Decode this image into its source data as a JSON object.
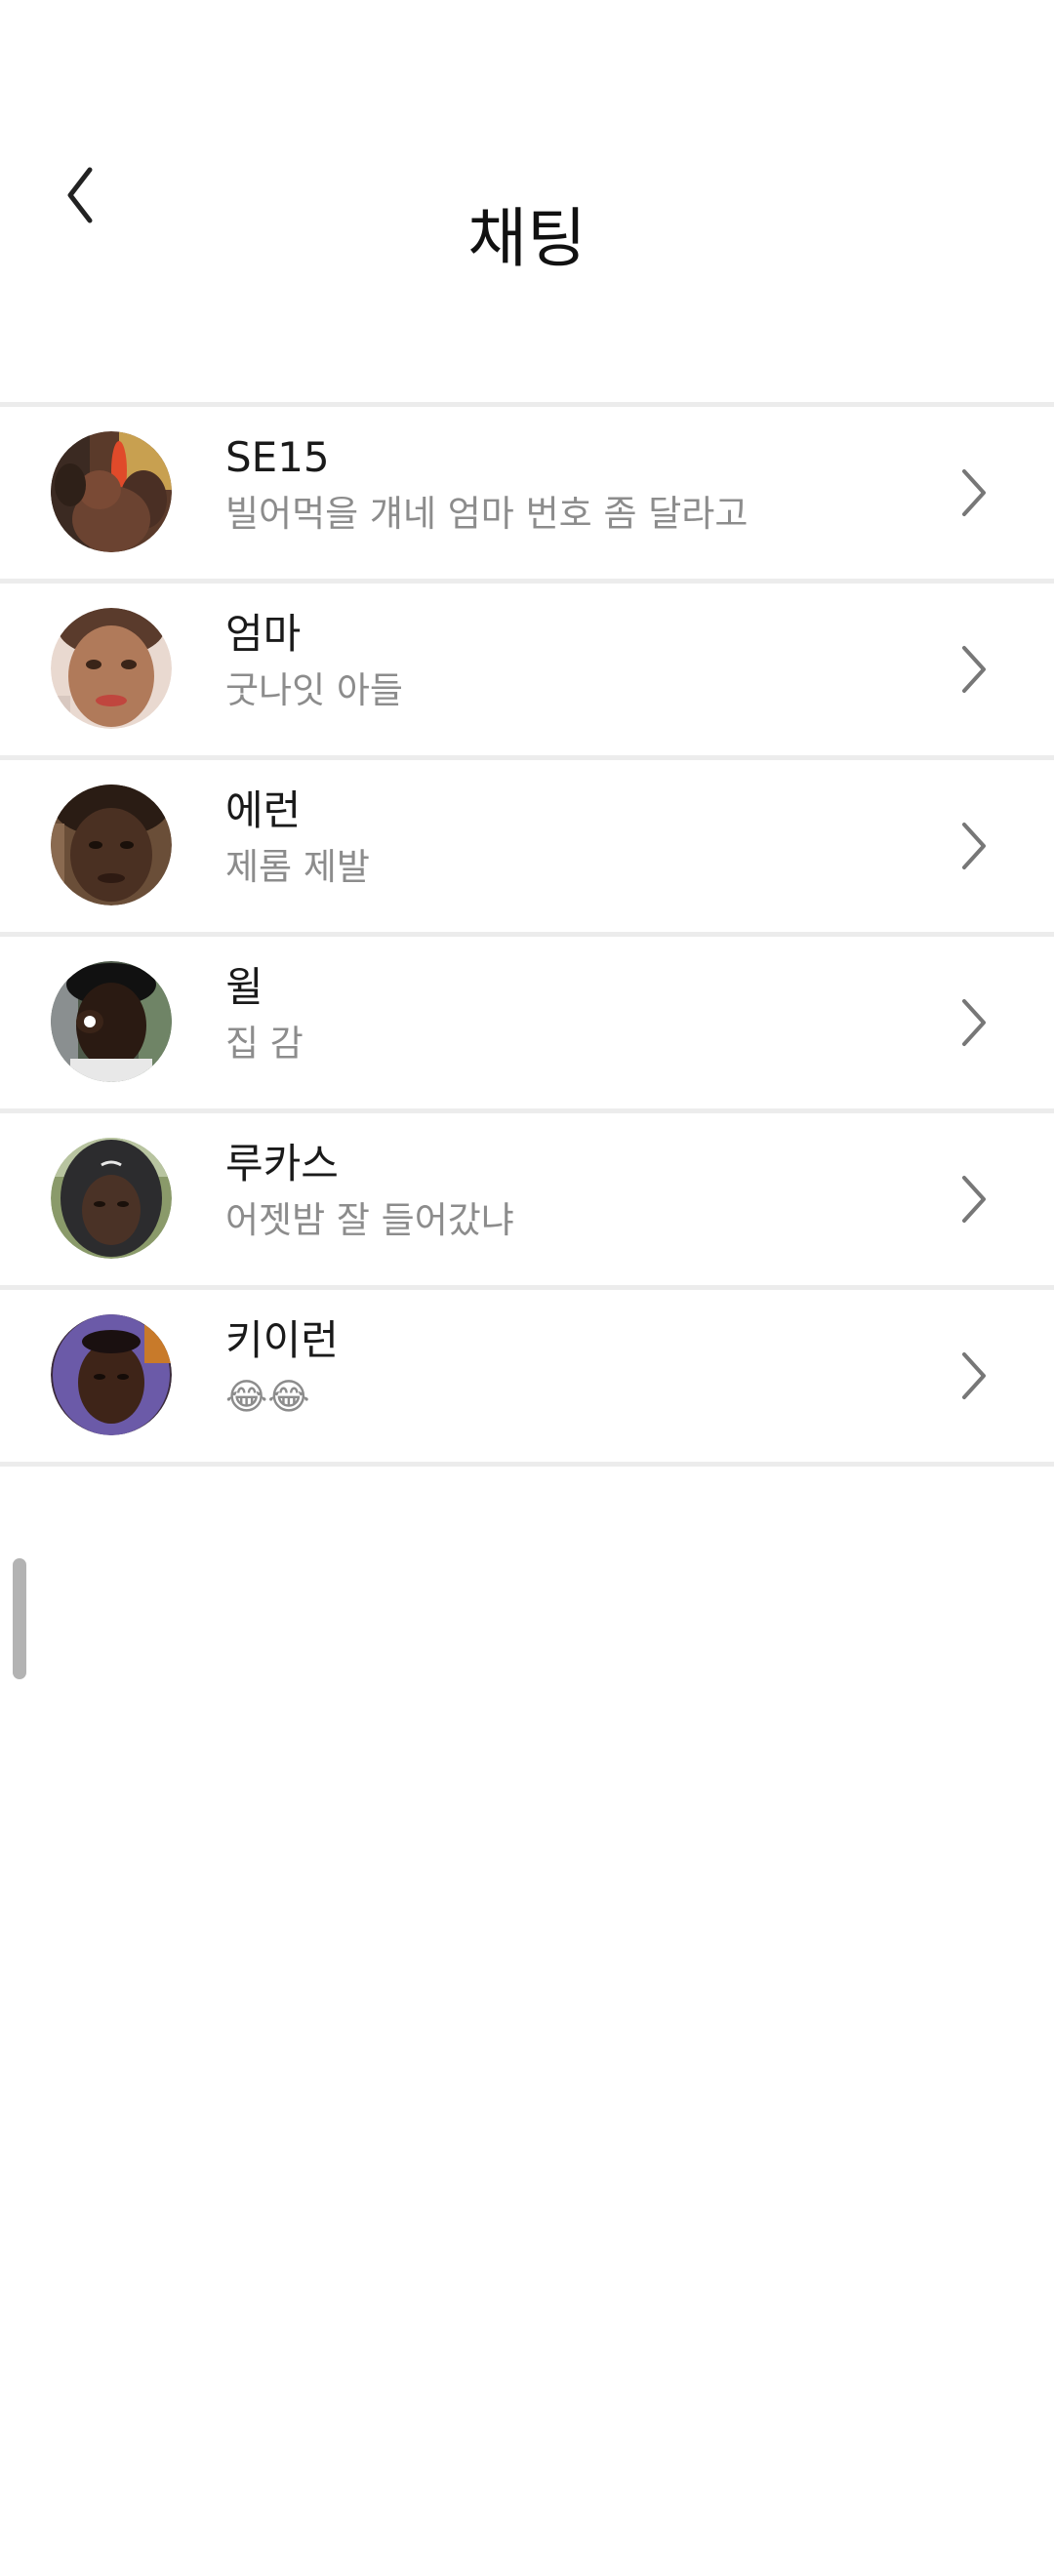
{
  "header": {
    "title": "채팅",
    "back_icon": "chevron-left-icon"
  },
  "chats": [
    {
      "name": "SE15",
      "preview": "빌어먹을 걔네 엄마 번호 좀 달라고",
      "avatar": "group-photo-avatar"
    },
    {
      "name": "엄마",
      "preview": "굿나잇 아들",
      "avatar": "photo-avatar"
    },
    {
      "name": "에런",
      "preview": "제롬 제발",
      "avatar": "photo-avatar"
    },
    {
      "name": "윌",
      "preview": "집 감",
      "avatar": "photo-avatar"
    },
    {
      "name": "루카스",
      "preview": "어젯밤 잘 들어갔냐",
      "avatar": "photo-avatar"
    },
    {
      "name": "키이런",
      "preview": "😂😂",
      "avatar": "photo-avatar"
    }
  ],
  "colors": {
    "divider": "#ececec",
    "preview_text": "#8c8c8c",
    "chevron": "#777777"
  }
}
